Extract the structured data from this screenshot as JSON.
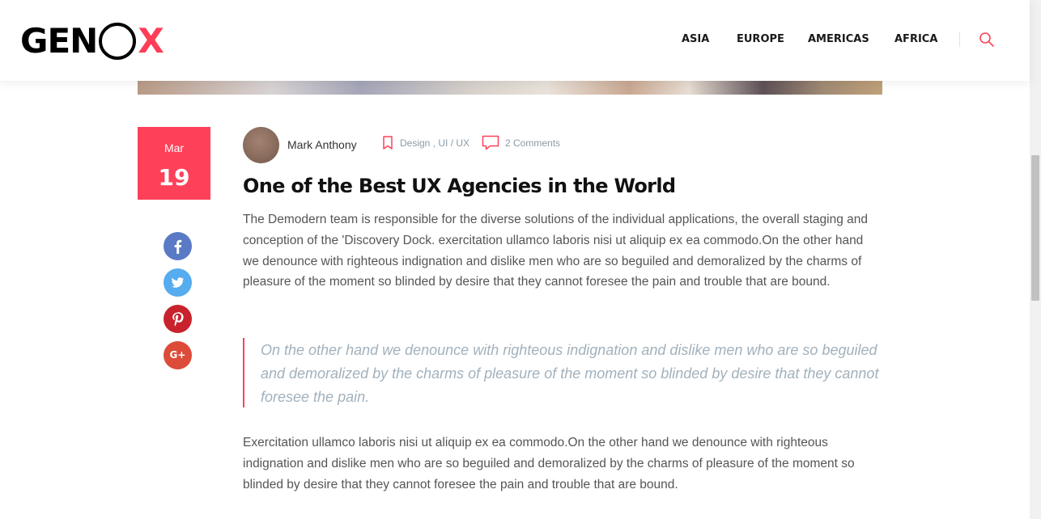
{
  "logo": {
    "text_left": "GEN",
    "text_right": "X"
  },
  "nav": {
    "items": [
      "ASIA",
      "EUROPE",
      "AMERICAS",
      "AFRICA"
    ]
  },
  "colors": {
    "accent": "#ff4059",
    "facebook": "#3b5998",
    "twitter": "#55acee",
    "pinterest": "#cb2027",
    "google_plus": "#dd4b39"
  },
  "post": {
    "date": {
      "month": "Mar",
      "day": "19"
    },
    "author": "Mark Anthony",
    "categories": "Design , UI / UX",
    "comments": "2 Comments",
    "title": "One of the Best UX Agencies in the World",
    "paragraph1": "The Demodern team is responsible for the diverse solutions of the individual applications, the overall staging and conception of the 'Discovery Dock. exercitation ullamco laboris nisi ut aliquip ex ea commodo.On the other hand we denounce with righteous indignation and dislike men who are so beguiled and demoralized by the charms of pleasure of the moment so blinded by desire that they cannot foresee the pain and trouble that are bound.",
    "quote": "On the other hand we denounce with righteous indignation and dislike men who are so beguiled and demoralized by the charms of pleasure of the moment so blinded by desire that they cannot foresee the pain.",
    "paragraph2": "Exercitation ullamco laboris nisi ut aliquip ex ea commodo.On the other hand we denounce with righteous indignation and dislike men who are so beguiled and demoralized by the charms of pleasure of the moment so blinded by desire that they cannot foresee the pain and trouble that are bound."
  },
  "share": {
    "facebook_icon": "f",
    "twitter_icon": "twitter-bird",
    "pinterest_icon": "p",
    "google_plus_icon": "G+"
  }
}
